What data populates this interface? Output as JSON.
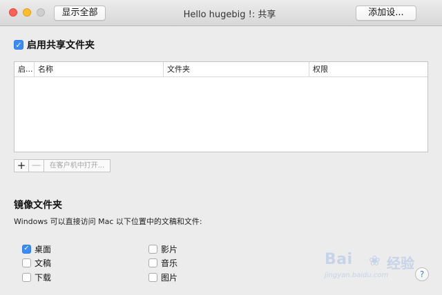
{
  "window": {
    "title": "Hello hugebig !: 共享",
    "show_all_label": "显示全部",
    "add_settings_label": "添加设..."
  },
  "enable_sharing": {
    "label": "启用共享文件夹",
    "checked": true
  },
  "table": {
    "columns": [
      {
        "key": "enabled",
        "label": "启..."
      },
      {
        "key": "name",
        "label": "名称"
      },
      {
        "key": "folder",
        "label": "文件夹"
      },
      {
        "key": "permission",
        "label": "权限"
      }
    ],
    "rows": []
  },
  "toolbar": {
    "add_label": "+",
    "remove_label": "—",
    "open_on_client_label": "在客户机中打开..."
  },
  "mirror": {
    "title": "镜像文件夹",
    "description": "Windows 可以直接访问 Mac 以下位置中的文稿和文件:",
    "options": [
      {
        "label": "桌面",
        "checked": true
      },
      {
        "label": "文稿",
        "checked": false
      },
      {
        "label": "下载",
        "checked": false
      },
      {
        "label": "影片",
        "checked": false
      },
      {
        "label": "音乐",
        "checked": false
      },
      {
        "label": "图片",
        "checked": false
      }
    ]
  },
  "watermark": {
    "logo": "Bai",
    "logo_cn": "经验",
    "url": "jingyan.baidu.com"
  },
  "help": {
    "label": "?"
  },
  "icons": {
    "checkbox_checked": "checkmark-icon",
    "paw": "baidu-paw-icon"
  },
  "colors": {
    "accent": "#3b8cf6",
    "close": "#ff5f57",
    "minimize": "#febc2e",
    "zoom_disabled": "#cfcfcf"
  }
}
